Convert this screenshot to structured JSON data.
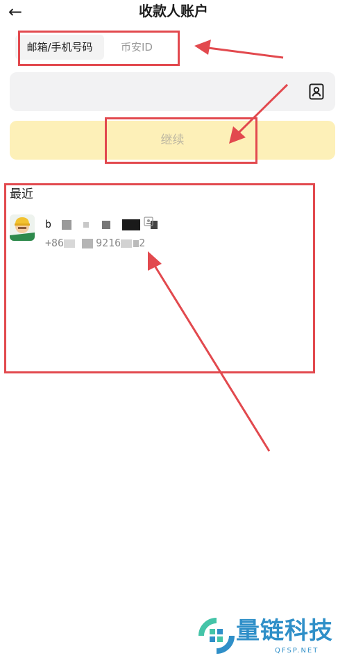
{
  "header": {
    "back_icon": "arrow-left-icon",
    "title": "收款人账户"
  },
  "tabs": [
    {
      "label": "邮箱/手机号码",
      "active": true
    },
    {
      "label": "币安ID",
      "active": false
    }
  ],
  "input": {
    "value": "",
    "placeholder": "",
    "trailing_icon": "contacts-icon"
  },
  "continue_button": {
    "label": "继续",
    "enabled": false
  },
  "recent": {
    "title": "最近",
    "contacts": [
      {
        "name_visible": "b",
        "phone_visible_prefix": "+86",
        "phone_visible_mid": "9216",
        "phone_visible_end": "2",
        "avatar": "avatar-icon"
      }
    ]
  },
  "watermark": {
    "text": "量链科技",
    "sub": "QFSP.NET"
  },
  "colors": {
    "annotation_red": "#e2494e",
    "button_disabled_bg": "#fdf0b8",
    "input_bg": "#f2f2f3",
    "brand_blue": "#2f8fc8"
  }
}
